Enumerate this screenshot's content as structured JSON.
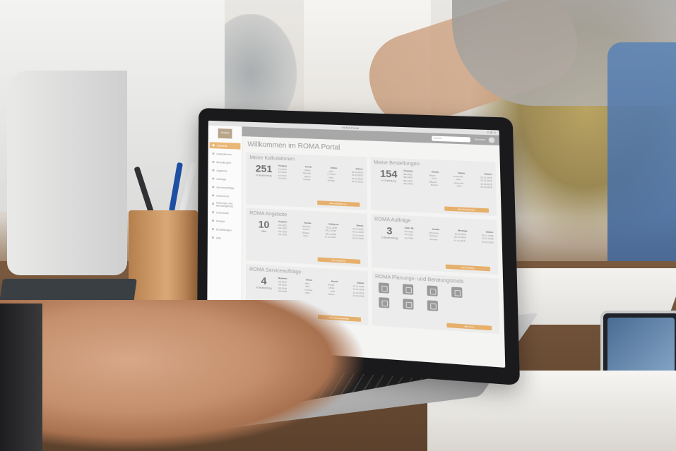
{
  "window": {
    "title": "ROMA Portal"
  },
  "sidebar": {
    "logo_text": "ROMA",
    "items": [
      {
        "label": "Startseite",
        "active": true
      },
      {
        "label": "Kalkulationen"
      },
      {
        "label": "Bestellungen"
      },
      {
        "label": "Angebote"
      },
      {
        "label": "Aufträge"
      },
      {
        "label": "Serviceaufträge"
      },
      {
        "label": "Dokumente"
      },
      {
        "label": "Planungs- und Beratungstools"
      },
      {
        "label": "Downloads"
      },
      {
        "label": "Kontakt"
      },
      {
        "label": "Einstellungen"
      },
      {
        "label": "Hilfe"
      }
    ]
  },
  "topbar": {
    "search_placeholder": "Suche...",
    "user_name": "Benutzer"
  },
  "page_title": "Willkommen im ROMA Portal",
  "cards": [
    {
      "title": "Meine Kalkulationen",
      "count": "251",
      "count_label": "in Bearbeitung",
      "columns": [
        "Vorgang",
        "Kunde",
        "Status",
        "Datum"
      ],
      "rows": [
        [
          "KA-0125",
          "Müller",
          "offen",
          "02.11.2018"
        ],
        [
          "KA-0124",
          "Schmidt",
          "in Arbeit",
          "01.11.2018"
        ],
        [
          "KA-0123",
          "Weber",
          "offen",
          "31.10.2018"
        ],
        [
          "KA-0122",
          "Fischer",
          "erledigt",
          "30.10.2018"
        ]
      ],
      "button": "Alle Kalkulationen"
    },
    {
      "title": "Meine Bestellungen",
      "count": "154",
      "count_label": "in Zustellung",
      "columns": [
        "Vorgang",
        "Kunde",
        "Status",
        "Datum"
      ],
      "rows": [
        [
          "BE-0451",
          "Bauer",
          "versendet",
          "02.11.2018"
        ],
        [
          "BE-0450",
          "Koch",
          "offen",
          "01.11.2018"
        ],
        [
          "BE-0449",
          "Wagner",
          "versendet",
          "31.10.2018"
        ],
        [
          "BE-0448",
          "Becker",
          "offen",
          "30.10.2018"
        ]
      ],
      "button": "Alle Bestellungen"
    },
    {
      "title": "ROMA Angebote",
      "count": "10",
      "count_label": "offen",
      "columns": [
        "Angebot",
        "Kunde",
        "Gültig bis",
        "Datum"
      ],
      "rows": [
        [
          "AN-1021",
          "Hofmann",
          "30.11.2018",
          "02.11.2018"
        ],
        [
          "AN-1020",
          "Schulz",
          "29.11.2018",
          "01.11.2018"
        ],
        [
          "AN-1019",
          "Richter",
          "28.11.2018",
          "31.10.2018"
        ],
        [
          "AN-1018",
          "Klein",
          "27.11.2018",
          "30.10.2018"
        ]
      ],
      "button": "Alle Angebote"
    },
    {
      "title": "ROMA Aufträge",
      "count": "3",
      "count_label": "in Bearbeitung",
      "columns": [
        "Auftr.-Nr.",
        "Kunde",
        "Montage",
        "Datum"
      ],
      "rows": [
        [
          "AU-3312",
          "Neumann",
          "05.11.2018",
          "02.11.2018"
        ],
        [
          "AU-3311",
          "Schwarz",
          "06.11.2018",
          "01.11.2018"
        ],
        [
          "AU-3310",
          "Zimmer",
          "07.11.2018",
          "31.10.2018"
        ]
      ],
      "button": "Alle Aufträge"
    },
    {
      "title": "ROMA Serviceaufträge",
      "count": "4",
      "count_label": "in Bearbeitung",
      "columns": [
        "Nummer",
        "Status",
        "Kunde",
        "Datum"
      ],
      "rows": [
        [
          "SE-0211",
          "offen",
          "Krüger",
          "02.11.2018"
        ],
        [
          "SE-0210",
          "offen",
          "Lange",
          "01.11.2018"
        ],
        [
          "SE-0209",
          "in Arbeit",
          "Wolf",
          "31.10.2018"
        ],
        [
          "SE-0208",
          "offen",
          "Braun",
          "30.10.2018"
        ]
      ],
      "button": "Alle Serviceaufträge"
    },
    {
      "title": "ROMA Planungs- und Beratungstools",
      "icons": [
        "planner-icon",
        "configurator-icon",
        "calculator-icon",
        "catalog-icon",
        "document-icon",
        "color-icon",
        "measure-icon"
      ],
      "button": "Alle Tools"
    }
  ],
  "colors": {
    "accent": "#e6b06c",
    "topbar": "#a8a8a8",
    "card": "#ececec"
  }
}
